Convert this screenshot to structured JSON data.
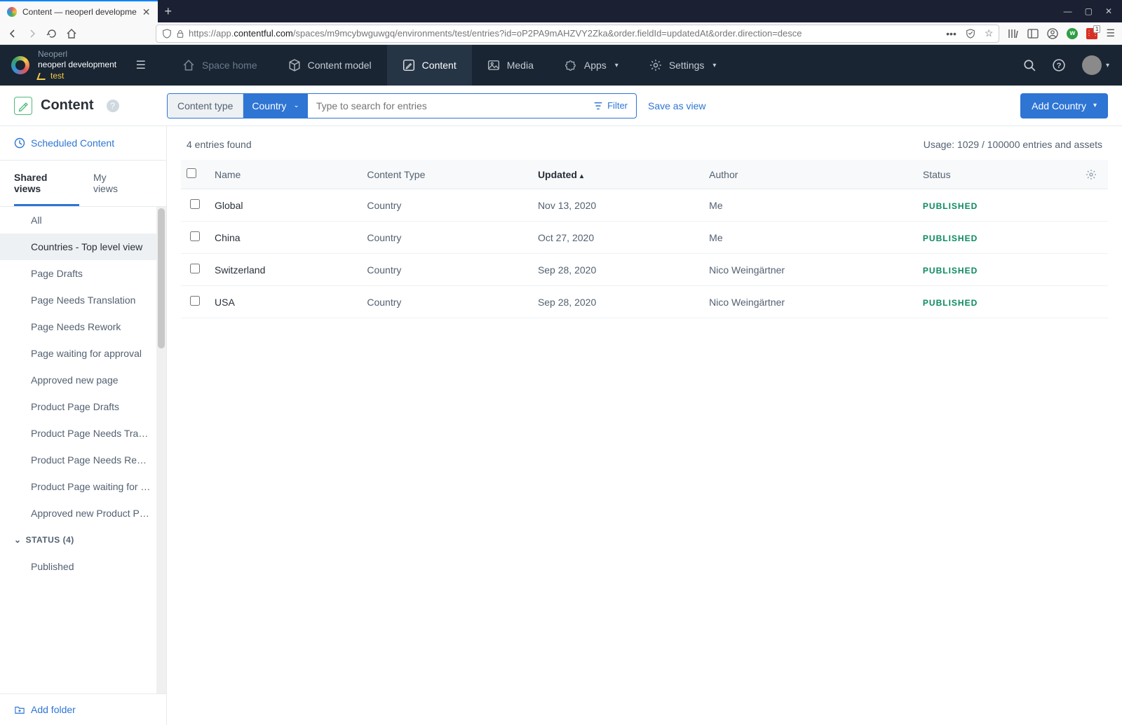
{
  "browser": {
    "tab_title": "Content — neoperl developme",
    "url_prefix": "https://app.",
    "url_domain": "contentful.com",
    "url_path": "/spaces/m9mcybwguwgq/environments/test/entries?id=oP2PA9mAHZVY2Zka&order.fieldId=updatedAt&order.direction=desce"
  },
  "brand": {
    "org": "Neoperl",
    "space": "neoperl development",
    "env": "test"
  },
  "topnav": {
    "space_home": "Space home",
    "content_model": "Content model",
    "content": "Content",
    "media": "Media",
    "apps": "Apps",
    "settings": "Settings"
  },
  "page": {
    "title": "Content",
    "content_type_label": "Content type",
    "content_type_value": "Country",
    "search_placeholder": "Type to search for entries",
    "filter": "Filter",
    "save_as_view": "Save as view",
    "add_button": "Add Country"
  },
  "sidebar": {
    "scheduled": "Scheduled Content",
    "tab_shared": "Shared views",
    "tab_my": "My views",
    "views": [
      "All",
      "Countries - Top level view",
      "Page Drafts",
      "Page Needs Translation",
      "Page Needs Rework",
      "Page waiting for approval",
      "Approved new page",
      "Product Page Drafts",
      "Product Page Needs Transla...",
      "Product Page Needs Rework",
      "Product Page waiting for ap...",
      "Approved new Product Page"
    ],
    "selected_index": 1,
    "status_group": "STATUS (4)",
    "status_views": [
      "Published"
    ],
    "add_folder": "Add folder"
  },
  "table": {
    "entries_found": "4 entries found",
    "usage": "Usage: 1029 / 100000 entries and assets",
    "col_name": "Name",
    "col_type": "Content Type",
    "col_updated": "Updated",
    "col_author": "Author",
    "col_status": "Status",
    "rows": [
      {
        "name": "Global",
        "type": "Country",
        "updated": "Nov 13, 2020",
        "author": "Me",
        "status": "PUBLISHED"
      },
      {
        "name": "China",
        "type": "Country",
        "updated": "Oct 27, 2020",
        "author": "Me",
        "status": "PUBLISHED"
      },
      {
        "name": "Switzerland",
        "type": "Country",
        "updated": "Sep 28, 2020",
        "author": "Nico Weingärtner",
        "status": "PUBLISHED"
      },
      {
        "name": "USA",
        "type": "Country",
        "updated": "Sep 28, 2020",
        "author": "Nico Weingärtner",
        "status": "PUBLISHED"
      }
    ]
  }
}
